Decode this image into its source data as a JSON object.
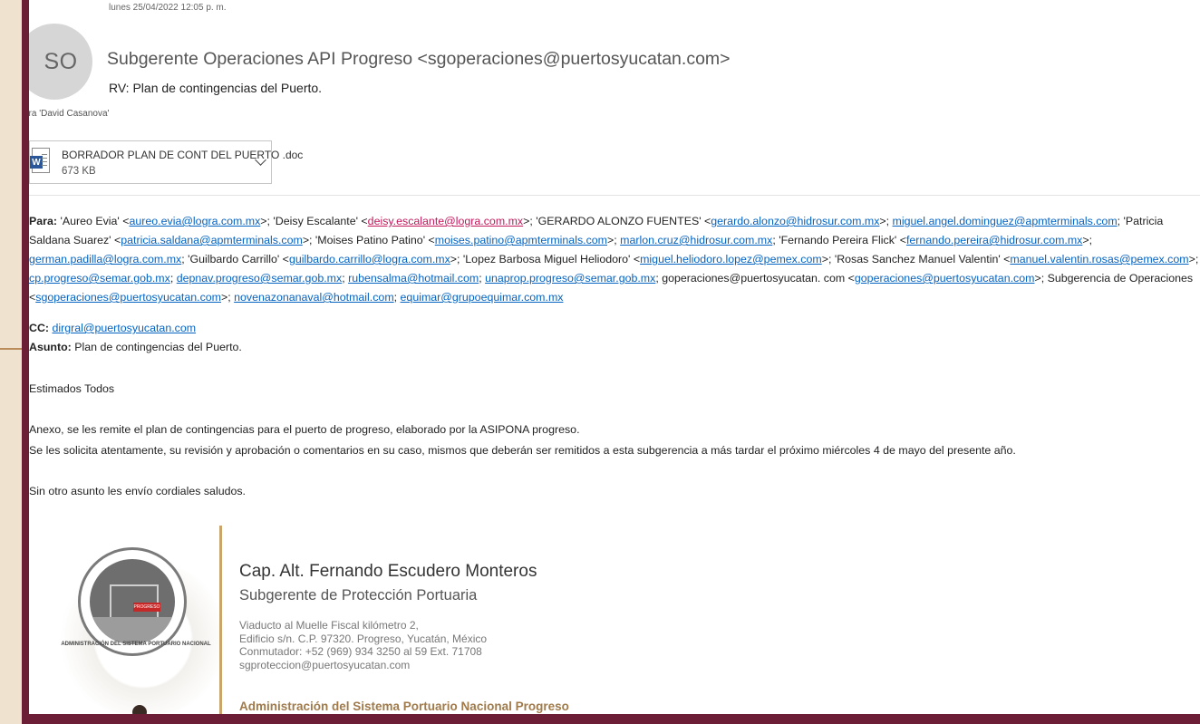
{
  "email": {
    "avatar_initials": "SO",
    "date": "lunes 25/04/2022 12:05 p. m.",
    "sender": "Subgerente Operaciones API Progreso <sgoperaciones@puertosyucatan.com>",
    "subject": "RV: Plan de contingencias del Puerto.",
    "to_line": "ara  'David Casanova'",
    "attachment": {
      "name": "BORRADOR PLAN DE CONT  DEL PUERTO .doc",
      "size": "673 KB",
      "icon": "word-doc-icon"
    }
  },
  "body": {
    "para_label": "Para:",
    "recipients": [
      {
        "text": "'Aureo Evia' <"
      },
      {
        "link": "aureo.evia@logra.com.mx"
      },
      {
        "text": ">; 'Deisy Escalante' <"
      },
      {
        "link": "deisy.escalante@logra.com.mx",
        "pink": true
      },
      {
        "text": ">; 'GERARDO ALONZO FUENTES' <"
      },
      {
        "link": "gerardo.alonzo@hidrosur.com.mx"
      },
      {
        "text": ">; "
      },
      {
        "link": "miguel.angel.dominguez@apmterminals.com"
      },
      {
        "text": "; 'Patricia Saldana Suarez' <"
      },
      {
        "link": "patricia.saldana@apmterminals.com"
      },
      {
        "text": ">; 'Moises Patino Patino' <"
      },
      {
        "link": "moises.patino@apmterminals.com"
      },
      {
        "text": ">; "
      },
      {
        "link": "marlon.cruz@hidrosur.com.mx"
      },
      {
        "text": "; 'Fernando Pereira Flick' <"
      },
      {
        "link": "fernando.pereira@hidrosur.com.mx"
      },
      {
        "text": ">; "
      },
      {
        "link": "german.padilla@logra.com.mx"
      },
      {
        "text": "; 'Guilbardo Carrillo' <"
      },
      {
        "link": "guilbardo.carrillo@logra.com.mx"
      },
      {
        "text": ">; 'Lopez Barbosa Miguel Heliodoro' <"
      },
      {
        "link": "miguel.heliodoro.lopez@pemex.com"
      },
      {
        "text": ">; 'Rosas Sanchez Manuel Valentin' <"
      },
      {
        "link": "manuel.valentin.rosas@pemex.com"
      },
      {
        "text": ">; "
      },
      {
        "link": "cp.progreso@semar.gob.mx"
      },
      {
        "text": "; "
      },
      {
        "link": "depnav.progreso@semar.gob.mx"
      },
      {
        "text": "; "
      },
      {
        "link": "rubensalma@hotmail.com"
      },
      {
        "text": "; "
      },
      {
        "link": "unaprop.progreso@semar.gob.mx"
      },
      {
        "text": "; goperaciones@puertosyucatan. com <"
      },
      {
        "link": "goperaciones@puertosyucatan.com"
      },
      {
        "text": ">; Subgerencia de Operaciones <"
      },
      {
        "link": "sgoperaciones@puertosyucatan.com"
      },
      {
        "text": ">; "
      },
      {
        "link": "novenazonanaval@hotmail.com"
      },
      {
        "text": "; "
      },
      {
        "link": "equimar@grupoequimar.com.mx"
      }
    ],
    "cc_label": "CC:",
    "cc": "dirgral@puertosyucatan.com",
    "asunto_label": "Asunto:",
    "asunto": "Plan de contingencias del Puerto.",
    "greeting": "Estimados Todos",
    "paragraph1": "Anexo, se les remite  el plan de contingencias para el puerto de progreso, elaborado por la ASIPONA progreso.",
    "paragraph2": "Se les solicita atentamente, su revisión y aprobación o comentarios en su caso, mismos que deberán ser remitidos a esta subgerencia  a más tardar el próximo miércoles 4 de mayo del presente año.",
    "closing": "Sin otro asunto les envío cordiales saludos."
  },
  "signature": {
    "name": "Cap. Alt. Fernando Escudero Monteros",
    "role": "Subgerente de Protección Portuaria",
    "address_lines": [
      "Viaducto al Muelle Fiscal kilómetro 2,",
      "Edificio s/n. C.P. 97320. Progreso, Yucatán, México",
      "Conmutador: +52 (969) 934 3250 al 59 Ext. 71708",
      "sgproteccion@puertosyucatan.com"
    ],
    "org": "Administración del Sistema Portuario Nacional Progreso",
    "logo_badge": "PROGRESO",
    "logo_ring": "ADMINISTRACIÓN DEL SISTEMA PORTUARIO NACIONAL"
  }
}
